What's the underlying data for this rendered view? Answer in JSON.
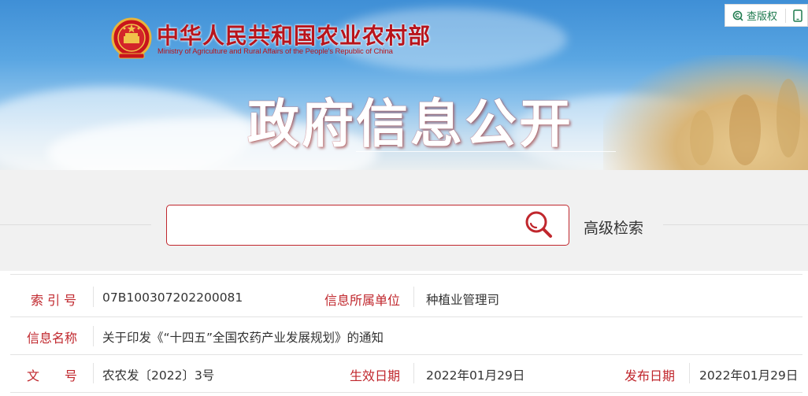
{
  "header": {
    "ministry_cn": "中华人民共和国农业农村部",
    "ministry_en": "Ministry of Agriculture and Rural Affairs of the People's Republic of China",
    "big_title": "政府信息公开",
    "tools": {
      "check_rights_label": "查版权",
      "check_rights_icon": "copyright-search-icon",
      "mobile_icon": "mobile-phone-icon"
    }
  },
  "search": {
    "placeholder": "",
    "value": "",
    "advanced_label": "高级检索",
    "icon": "search-icon"
  },
  "info": {
    "index_label": "索 引 号",
    "index_value": "07B100307202200081",
    "unit_label": "信息所属单位",
    "unit_value": "种植业管理司",
    "name_label": "信息名称",
    "name_value": "关于印发《“十四五”全国农药产业发展规划》的通知",
    "doc_label": "文　　号",
    "doc_value": "农农发〔2022〕3号",
    "effective_label": "生效日期",
    "effective_value": "2022年01月29日",
    "publish_label": "发布日期",
    "publish_value": "2022年01月29日"
  },
  "colors": {
    "accent_red": "#c0272d",
    "tool_green": "#1f7b4f",
    "sky_blue": "#4f9ede"
  }
}
